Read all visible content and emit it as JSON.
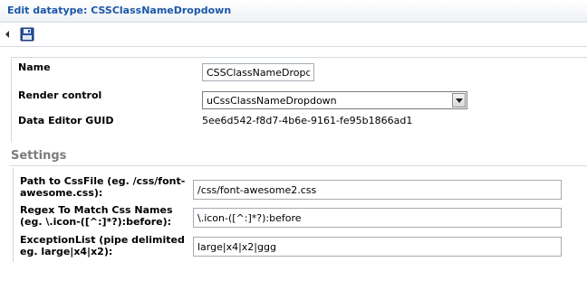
{
  "window": {
    "title": "Edit datatype: CSSClassNameDropdown"
  },
  "toolbar": {
    "save_icon": "save-icon"
  },
  "general": {
    "name_label": "Name",
    "name_value": "CSSClassNameDropdown",
    "render_control_label": "Render control",
    "render_control_value": "uCssClassNameDropdown",
    "guid_label": "Data Editor GUID",
    "guid_value": "5ee6d542-f8d7-4b6e-9161-fe95b1866ad1"
  },
  "settings": {
    "header": "Settings",
    "path_label": "Path to CssFile (eg. /css/font-awesome.css):",
    "path_value": "/css/font-awesome2.css",
    "regex_label": "Regex To Match Css Names (eg. \\.icon-([^:]*?):before):",
    "regex_value": "\\.icon-([^:]*?):before",
    "exception_label": "ExceptionList (pipe delimited eg. large|x4|x2):",
    "exception_value": "large|x4|x2|ggg"
  },
  "colors": {
    "title": "#1a57a8",
    "section": "#7c7c7c",
    "border": "#d6dbe1"
  }
}
